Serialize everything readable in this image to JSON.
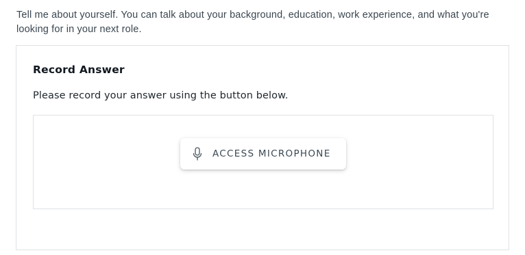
{
  "question": {
    "text": "Tell me about yourself. You can talk about your background, education, work experience, and what you're looking for in your next role."
  },
  "record_card": {
    "title": "Record Answer",
    "instructions": "Please record your answer using the button below.",
    "access_button": {
      "label": "ACCESS MICROPHONE",
      "icon": "microphone-icon"
    }
  },
  "colors": {
    "text_primary": "#121820",
    "text_secondary": "#3a4650",
    "border": "#dfe2e5",
    "button_text": "#3b4853"
  }
}
